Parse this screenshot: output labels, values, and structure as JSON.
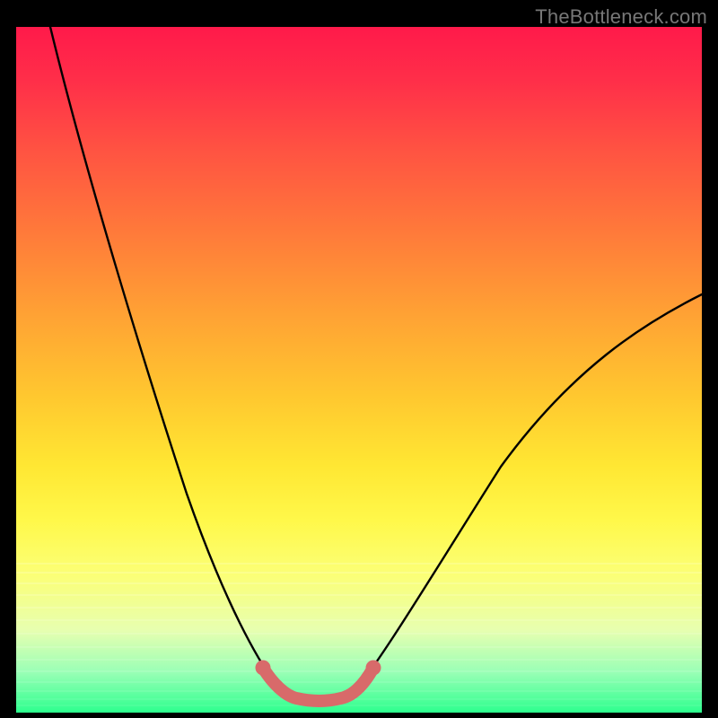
{
  "watermark": "TheBottleneck.com",
  "chart_data": {
    "type": "line",
    "title": "",
    "xlabel": "",
    "ylabel": "",
    "xlim": [
      0,
      100
    ],
    "ylim": [
      0,
      100
    ],
    "grid": false,
    "legend": false,
    "series": [
      {
        "name": "left-branch",
        "x": [
          5,
          8,
          12,
          16,
          20,
          24,
          28,
          31,
          34,
          36,
          37.5,
          39
        ],
        "y": [
          100,
          88,
          74,
          60,
          46,
          33,
          21,
          13,
          7,
          4,
          3,
          2.5
        ]
      },
      {
        "name": "flat-bottom",
        "x": [
          39,
          41,
          43,
          45,
          47,
          49
        ],
        "y": [
          2.5,
          2.2,
          2.1,
          2.1,
          2.2,
          2.5
        ]
      },
      {
        "name": "right-branch",
        "x": [
          49,
          51,
          54,
          58,
          62,
          67,
          72,
          78,
          85,
          92,
          100
        ],
        "y": [
          2.5,
          4,
          8,
          14,
          21,
          29,
          36,
          43,
          49,
          55,
          61
        ]
      },
      {
        "name": "overlay-salmon",
        "x": [
          36,
          37.5,
          39,
          41,
          43,
          45,
          47,
          49,
          50.5,
          52
        ],
        "y": [
          6.5,
          4,
          2.5,
          2.2,
          2.1,
          2.1,
          2.2,
          2.5,
          4,
          6.5
        ]
      }
    ],
    "colors": {
      "curve": "#000000",
      "overlay": "#d86a6a"
    }
  }
}
